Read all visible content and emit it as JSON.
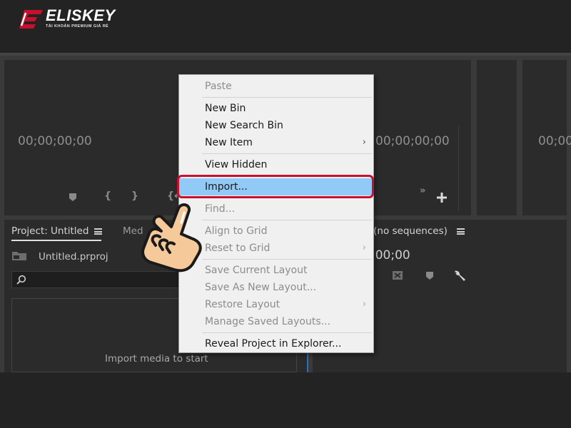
{
  "brand": {
    "name": "ELISKEY",
    "tagline": "TÀI KHOẢN PREMIUM GIÁ RẺ",
    "accent_color": "#c8102e"
  },
  "source_monitor": {
    "left_timecode": "00;00;00;00",
    "right_timecode": "00;00;00;00",
    "far_right_timecode": "00;00",
    "transport_icons": [
      "marker-icon",
      "mark-in-icon",
      "mark-out-icon",
      "go-to-in-icon"
    ],
    "overflow_icon": "chevron-double-right-icon",
    "add_button_icon": "plus-icon"
  },
  "project_panel": {
    "tab_label": "Project: Untitled",
    "second_tab_partial": "Med",
    "file_name": "Untitled.prproj",
    "search_placeholder": "",
    "empty_hint": "Import media to start"
  },
  "timeline_panel": {
    "tab_label_partial": "e: (no sequences)",
    "timecode": ";00;00",
    "tool_icons": [
      "snap-icon",
      "marker-icon",
      "wrench-icon"
    ]
  },
  "context_menu": {
    "items": [
      {
        "label": "Paste",
        "enabled": false,
        "submenu": false
      },
      {
        "label": "New Bin",
        "enabled": true,
        "submenu": false
      },
      {
        "label": "New Search Bin",
        "enabled": true,
        "submenu": false
      },
      {
        "label": "New Item",
        "enabled": true,
        "submenu": true
      },
      {
        "label": "View Hidden",
        "enabled": true,
        "submenu": false
      },
      {
        "label": "Import...",
        "enabled": true,
        "submenu": false,
        "highlighted": true
      },
      {
        "label": "Find...",
        "enabled": false,
        "submenu": false
      },
      {
        "label": "Align to Grid",
        "enabled": false,
        "submenu": false
      },
      {
        "label": "Reset to Grid",
        "enabled": false,
        "submenu": true
      },
      {
        "label": "Save Current Layout",
        "enabled": false,
        "submenu": false
      },
      {
        "label": "Save As New Layout...",
        "enabled": false,
        "submenu": false
      },
      {
        "label": "Restore Layout",
        "enabled": false,
        "submenu": true
      },
      {
        "label": "Manage Saved Layouts...",
        "enabled": false,
        "submenu": false
      },
      {
        "label": "Reveal Project in Explorer...",
        "enabled": true,
        "submenu": false
      }
    ],
    "submenu_arrow": "›",
    "highlight_color": "#91c9f7"
  },
  "annotation": {
    "ring_color": "#c8102e",
    "pointer_icon": "pointing-hand-icon"
  }
}
